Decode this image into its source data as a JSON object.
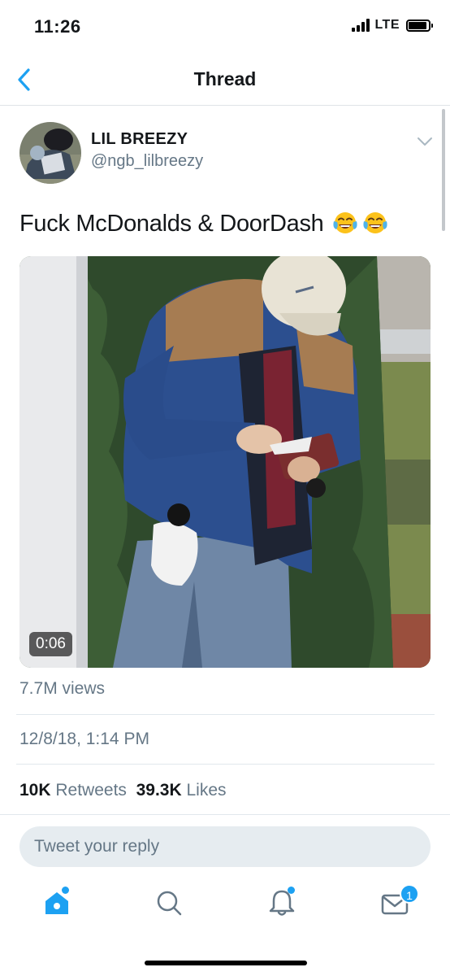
{
  "status_bar": {
    "time": "11:26",
    "network": "LTE",
    "battery_level": 0.9
  },
  "nav": {
    "title": "Thread",
    "back_icon": "chevron-left-icon"
  },
  "tweet": {
    "author_name": "LIL BREEZY",
    "author_handle": "@ngb_lilbreezy",
    "text": "Fuck McDonalds & DoorDash",
    "emojis": [
      "face-with-tears-of-joy",
      "face-with-tears-of-joy"
    ],
    "video_duration": "0:06",
    "views": "7.7M views",
    "timestamp": "12/8/18, 1:14 PM",
    "retweets_count": "10K",
    "retweets_label": "Retweets",
    "likes_count": "39.3K",
    "likes_label": "Likes"
  },
  "reply": {
    "placeholder": "Tweet your reply"
  },
  "tab_bar": {
    "tabs": [
      "home-icon",
      "search-icon",
      "notifications-icon",
      "messages-icon"
    ],
    "messages_badge": "1"
  },
  "colors": {
    "accent": "#1da1f2",
    "secondary_text": "#657786",
    "divider": "#e1e8ed"
  }
}
